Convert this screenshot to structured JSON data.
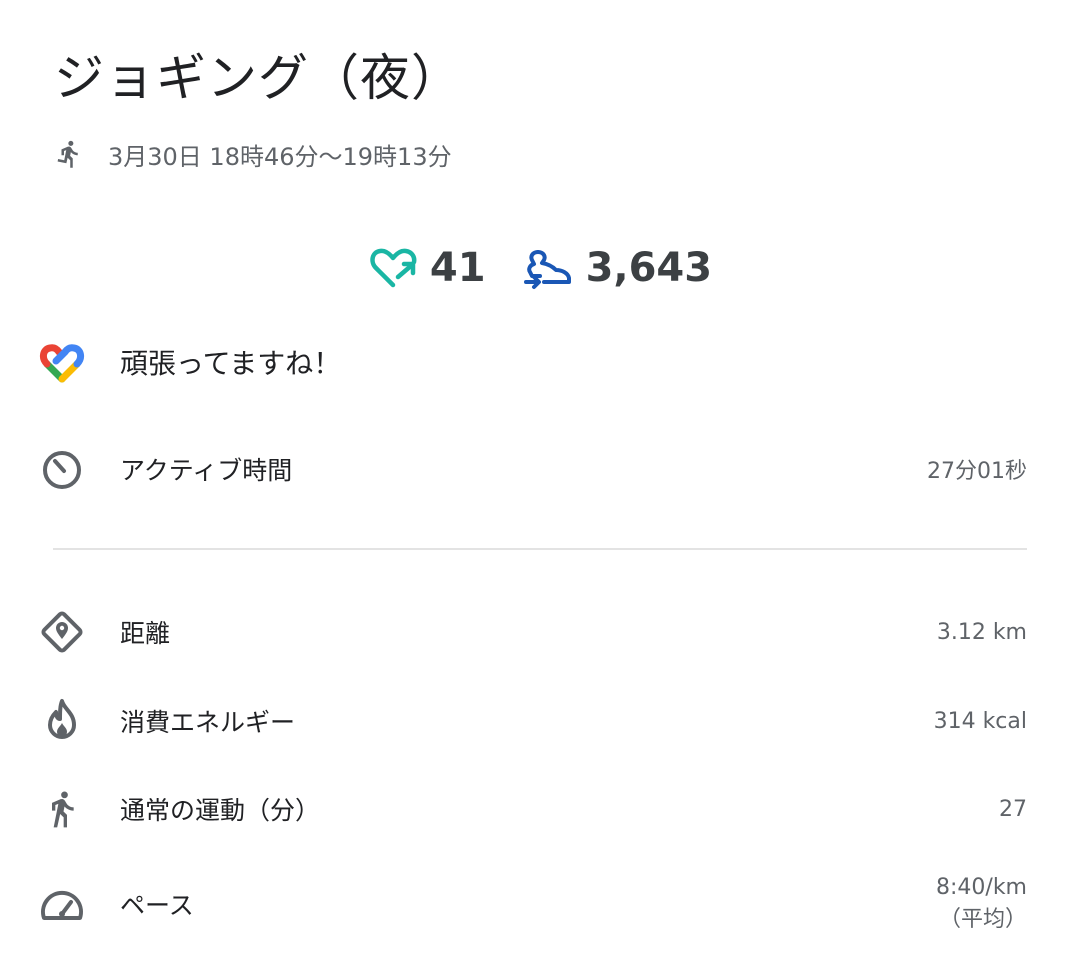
{
  "header": {
    "title": "ジョギング（夜）",
    "time_range": "3月30日 18時46分〜19時13分",
    "activity_icon": "running-icon"
  },
  "stats": {
    "heart_points": "41",
    "heart_points_icon": "heart-points-icon",
    "steps": "3,643",
    "steps_icon": "steps-icon",
    "heart_color": "#1ab6a4",
    "steps_color": "#1a57b5"
  },
  "praise": {
    "icon": "google-fit-logo",
    "text": "頑張ってますね！"
  },
  "active_time": {
    "icon": "timer-icon",
    "label": "アクティブ時間",
    "value": "27分01秒"
  },
  "metrics": [
    {
      "icon": "location-diamond-icon",
      "label": "距離",
      "value": "3.12 km"
    },
    {
      "icon": "flame-icon",
      "label": "消費エネルギー",
      "value": "314 kcal"
    },
    {
      "icon": "walking-icon",
      "label": "通常の運動（分）",
      "value": "27"
    },
    {
      "icon": "speedometer-icon",
      "label": "ペース",
      "value": "8:40/km",
      "note": "（平均）"
    }
  ]
}
